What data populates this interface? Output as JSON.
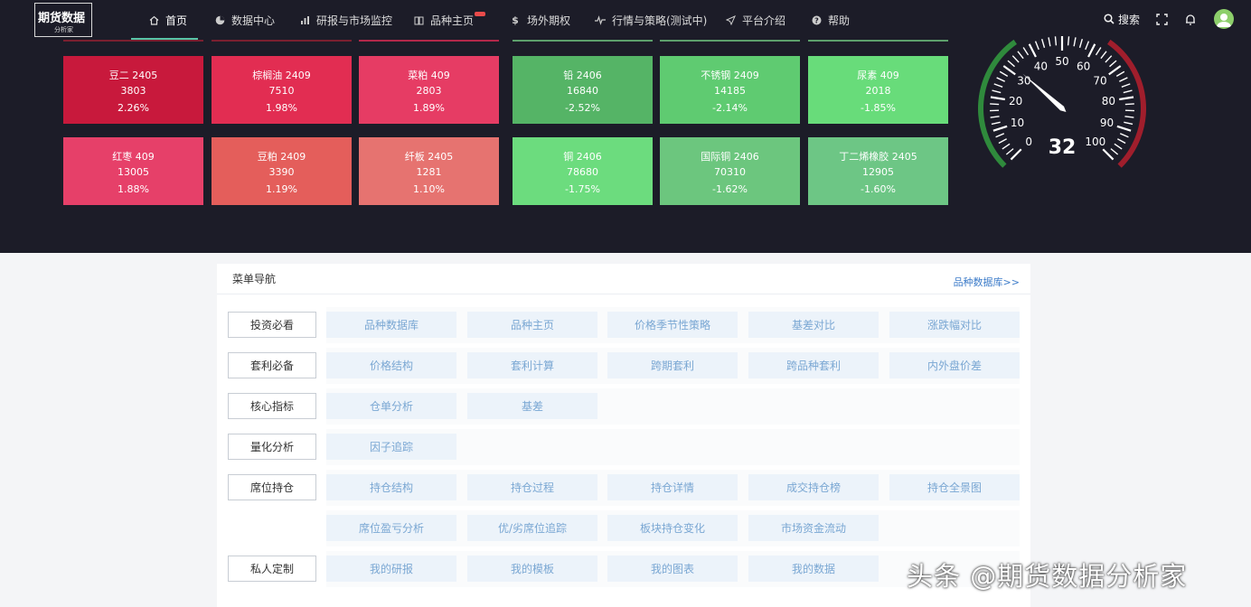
{
  "logo": {
    "title": "期货数据",
    "subtitle": "分析家"
  },
  "nav": [
    {
      "label": "首页",
      "icon": "home-icon"
    },
    {
      "label": "数据中心",
      "icon": "pie-chart-icon"
    },
    {
      "label": "研报与市场监控",
      "icon": "bar-chart-icon"
    },
    {
      "label": "品种主页",
      "icon": "book-icon"
    },
    {
      "label": "场外期权",
      "icon": "dollar-icon"
    },
    {
      "label": "行情与策略(测试中)",
      "icon": "pulse-icon"
    },
    {
      "label": "平台介绍",
      "icon": "send-icon"
    },
    {
      "label": "帮助",
      "icon": "help-icon"
    }
  ],
  "top_right": {
    "search_label": "搜索"
  },
  "colors": {
    "up": "#e8395a",
    "down": "#5cd77a",
    "accent": "#59c4a7",
    "link": "#3d7cc9"
  },
  "tiles_up": [
    {
      "name": "豆二 2405",
      "price": "3803",
      "change": "2.26%",
      "color": "#c8193c"
    },
    {
      "name": "棕榈油 2409",
      "price": "7510",
      "change": "1.98%",
      "color": "#e22d52"
    },
    {
      "name": "菜粕 409",
      "price": "2803",
      "change": "1.89%",
      "color": "#e63c64"
    },
    {
      "name": "红枣 409",
      "price": "13005",
      "change": "1.88%",
      "color": "#e64069"
    },
    {
      "name": "豆粕 2409",
      "price": "3390",
      "change": "1.19%",
      "color": "#e45e5b"
    },
    {
      "name": "纤板 2405",
      "price": "1281",
      "change": "1.10%",
      "color": "#e67370"
    }
  ],
  "tiles_down": [
    {
      "name": "铅 2406",
      "price": "16840",
      "change": "-2.52%",
      "color": "#55b466"
    },
    {
      "name": "不锈钢 2409",
      "price": "14185",
      "change": "-2.14%",
      "color": "#5fcb71"
    },
    {
      "name": "尿素 409",
      "price": "2018",
      "change": "-1.85%",
      "color": "#68dc7a"
    },
    {
      "name": "铜 2406",
      "price": "78680",
      "change": "-1.75%",
      "color": "#6cdc7e"
    },
    {
      "name": "国际铜 2406",
      "price": "70310",
      "change": "-1.62%",
      "color": "#6cc67e"
    },
    {
      "name": "丁二烯橡胶 2405",
      "price": "12905",
      "change": "-1.60%",
      "color": "#6dc685"
    }
  ],
  "gauge": {
    "value": 32,
    "value_text": "32",
    "min": 0,
    "max": 100,
    "tick_labels": [
      "0",
      "10",
      "20",
      "30",
      "40",
      "50",
      "60",
      "70",
      "80",
      "90",
      "100"
    ],
    "low_color": "#2f8a3c",
    "high_color": "#a01e2c"
  },
  "menu": {
    "title": "菜单导航",
    "db_link": "品种数据库>>",
    "rows": [
      {
        "category": "投资必看",
        "links": [
          "品种数据库",
          "品种主页",
          "价格季节性策略",
          "基差对比",
          "涨跌幅对比"
        ]
      },
      {
        "category": "套利必备",
        "links": [
          "价格结构",
          "套利计算",
          "跨期套利",
          "跨品种套利",
          "内外盘价差"
        ]
      },
      {
        "category": "核心指标",
        "links": [
          "仓单分析",
          "基差"
        ]
      },
      {
        "category": "量化分析",
        "links": [
          "因子追踪"
        ]
      },
      {
        "category": "席位持仓",
        "links": [
          "持仓结构",
          "持仓过程",
          "持仓详情",
          "成交持仓榜",
          "持仓全景图"
        ]
      },
      {
        "category": "",
        "links": [
          "席位盈亏分析",
          "优/劣席位追踪",
          "板块持仓变化",
          "市场资金流动"
        ]
      },
      {
        "category": "私人定制",
        "links": [
          "我的研报",
          "我的模板",
          "我的图表",
          "我的数据"
        ]
      }
    ]
  },
  "watermark": "头条 @期货数据分析家"
}
